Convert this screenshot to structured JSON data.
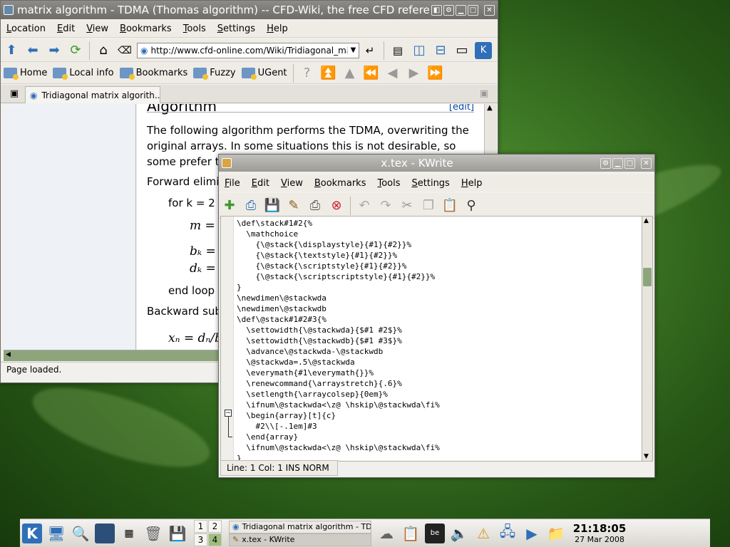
{
  "konqueror": {
    "title": "matrix algorithm - TDMA (Thomas algorithm) -- CFD-Wiki, the free CFD reference -",
    "menu": [
      "Location",
      "Edit",
      "View",
      "Bookmarks",
      "Tools",
      "Settings",
      "Help"
    ],
    "url": "http://www.cfd-online.com/Wiki/Tridiagonal_matrix",
    "bookmarks": [
      "Home",
      "Local info",
      "Bookmarks",
      "Fuzzy",
      "UGent"
    ],
    "tab": "Tridiagonal matrix algorith...",
    "status": "Page loaded.",
    "content": {
      "heading": "Algorithm",
      "edit": "[edit]",
      "para": "The following algorithm performs the TDMA, overwriting the original arrays. In some situations this is not desirable, so some prefer t",
      "forward": "Forward elimi",
      "for_k": "for k = 2",
      "m_eq": "m =",
      "b_eq": "bₖ =",
      "d_eq": "dₖ =",
      "end_loop": "end loop",
      "backward": "Backward sub",
      "x_eq": "xₙ = dₙ/b"
    }
  },
  "kwrite": {
    "title": "x.tex - KWrite",
    "menu": [
      "File",
      "Edit",
      "View",
      "Bookmarks",
      "Tools",
      "Settings",
      "Help"
    ],
    "code": "\\def\\stack#1#2{%\n  \\mathchoice\n    {\\@stack{\\displaystyle}{#1}{#2}}%\n    {\\@stack{\\textstyle}{#1}{#2}}%\n    {\\@stack{\\scriptstyle}{#1}{#2}}%\n    {\\@stack{\\scriptscriptstyle}{#1}{#2}}%\n}\n\\newdimen\\@stackwda\n\\newdimen\\@stackwdb\n\\def\\@stack#1#2#3{%\n  \\settowidth{\\@stackwda}{$#1 #2$}%\n  \\settowidth{\\@stackwdb}{$#1 #3$}%\n  \\advance\\@stackwda-\\@stackwdb\n  \\@stackwda=.5\\@stackwda\n  \\everymath{#1\\everymath{}}%\n  \\renewcommand{\\arraystretch}{.6}%\n  \\setlength{\\arraycolsep}{0em}%\n  \\ifnum\\@stackwda<\\z@ \\hskip\\@stackwda\\fi%\n  \\begin{array}[t]{c}\n    #2\\\\[-.1em]#3\n  \\end{array}\n  \\ifnum\\@stackwda<\\z@ \\hskip\\@stackwda\\fi%\n}",
    "status": "Line: 1 Col: 1  INS  NORM"
  },
  "panel": {
    "pager": [
      "1",
      "2",
      "3",
      "4"
    ],
    "tasks": [
      "Tridiagonal matrix algorithm - TDM",
      "x.tex - KWrite"
    ],
    "time": "21:18:05",
    "date": "27 Mar 2008"
  }
}
